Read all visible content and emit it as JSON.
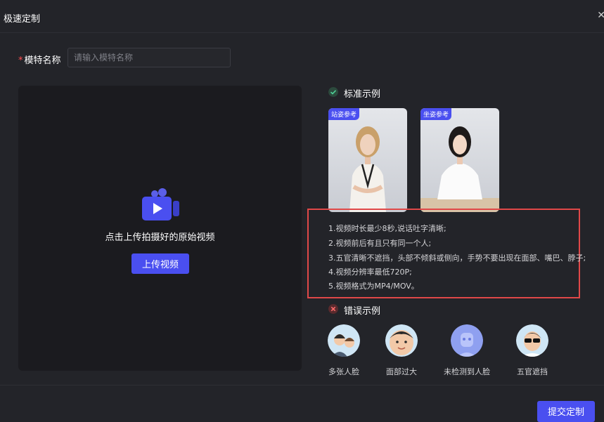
{
  "dialog": {
    "title": "极速定制",
    "close_icon": "close-icon"
  },
  "form": {
    "label": "模特名称",
    "required_mark": "*",
    "placeholder": "请输入模特名称",
    "value": ""
  },
  "upload": {
    "text": "点击上传拍摄好的原始视频",
    "button": "上传视频",
    "icon": "video-camera-icon"
  },
  "standard": {
    "title": "标准示例",
    "icon": "check-circle-icon",
    "examples": [
      {
        "tag": "站姿参考"
      },
      {
        "tag": "坐姿参考"
      }
    ],
    "rules": [
      "1.视频时长最少8秒,说话吐字清晰;",
      "2.视频前后有且只有同一个人;",
      "3.五官清晰不遮挡，头部不倾斜或侧向，手势不要出现在面部、嘴巴、脖子;",
      "4.视频分辨率最低720P;",
      "5.视频格式为MP4/MOV。"
    ]
  },
  "wrong": {
    "title": "错误示例",
    "icon": "x-circle-icon",
    "items": [
      {
        "label": "多张人脸"
      },
      {
        "label": "面部过大"
      },
      {
        "label": "未检测到人脸"
      },
      {
        "label": "五官遮挡"
      }
    ]
  },
  "footer": {
    "submit": "提交定制"
  },
  "colors": {
    "accent": "#4a4ff0",
    "highlight_border": "#e04848",
    "check": "#2f9e6f",
    "error": "#e04848"
  }
}
